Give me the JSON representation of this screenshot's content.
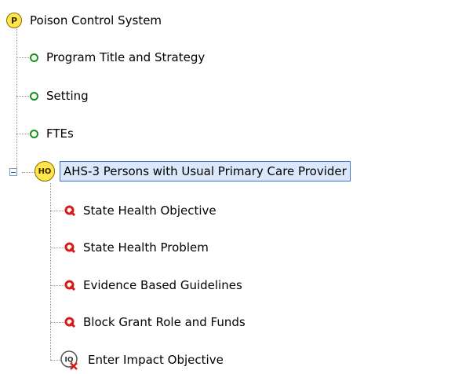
{
  "tree": {
    "root": {
      "badge": "P",
      "label": "Poison Control System"
    },
    "children": [
      {
        "label": "Program Title and Strategy"
      },
      {
        "label": "Setting"
      },
      {
        "label": "FTEs"
      }
    ],
    "selected_node": {
      "badge": "HO",
      "label": "AHS-3 Persons with Usual Primary Care Provider",
      "children": [
        {
          "label": "State Health Objective"
        },
        {
          "label": "State Health Problem"
        },
        {
          "label": "Evidence Based Guidelines"
        },
        {
          "label": "Block Grant Role and Funds"
        },
        {
          "badge": "IQ",
          "label": "Enter Impact Objective"
        }
      ]
    }
  },
  "colors": {
    "badge_yellow": "#ffe64d",
    "green_status": "#1b8f1b",
    "red_status": "#d81b1b",
    "selection_border": "#3b73d6"
  }
}
